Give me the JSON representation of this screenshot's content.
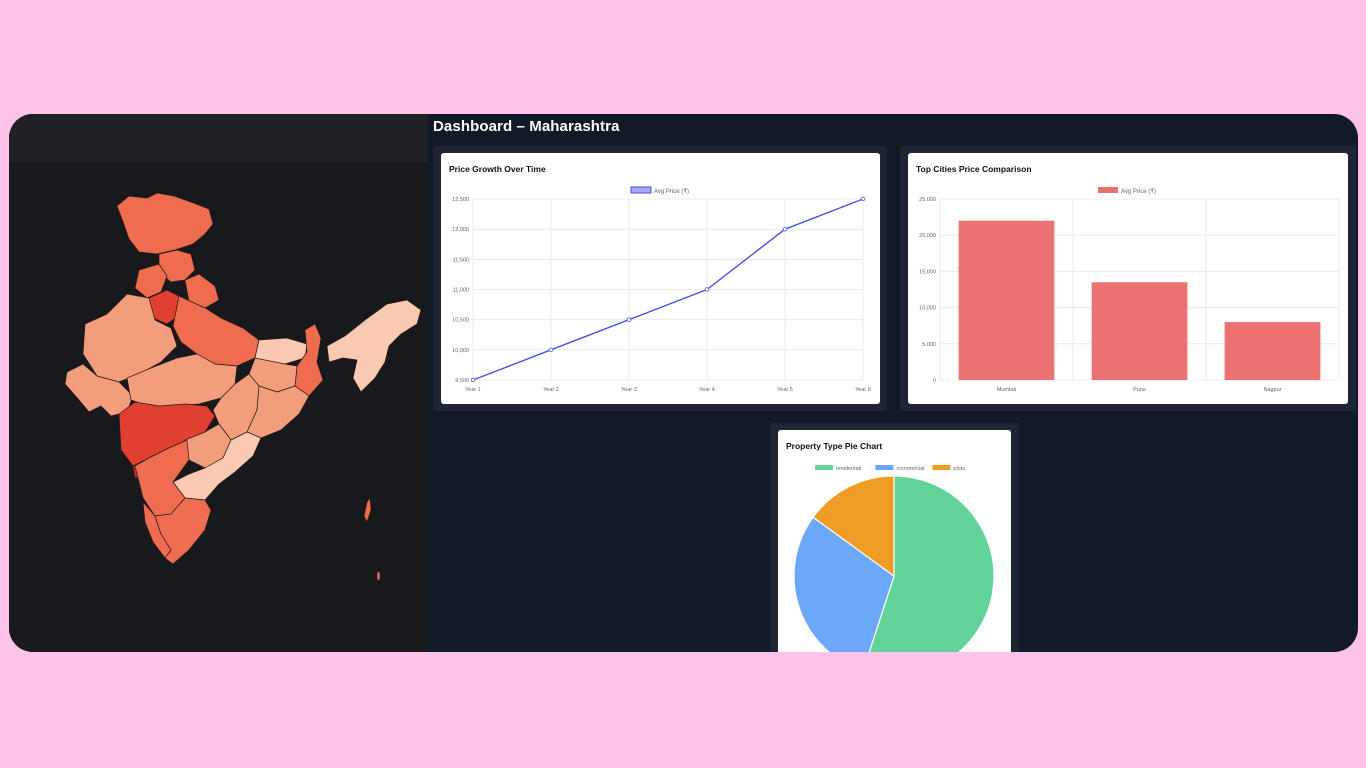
{
  "dashboard": {
    "title": "Dashboard – Maharashtra"
  },
  "map": {
    "selected_state": "Maharashtra",
    "fill_colors": [
      "#f9c9b2",
      "#f29e7c",
      "#ee6c4f",
      "#e23f33",
      "#d12e26"
    ]
  },
  "chart_data": [
    {
      "type": "line",
      "title": "Price Growth Over Time",
      "x": [
        "Year 1",
        "Year 2",
        "Year 3",
        "Year 4",
        "Year 5",
        "Year 6"
      ],
      "series": [
        {
          "name": "Avg Price (₹)",
          "values": [
            9500,
            10000,
            10500,
            11000,
            12000,
            12500
          ],
          "color": "#4b52e8"
        }
      ],
      "ylim": [
        9500,
        12500
      ],
      "yticks": [
        9500,
        10000,
        10500,
        11000,
        11500,
        12000,
        12500
      ],
      "ytick_labels": [
        "9,500",
        "10,000",
        "10,500",
        "11,000",
        "11,500",
        "12,000",
        "12,500"
      ],
      "grid": true,
      "legend": "top"
    },
    {
      "type": "bar",
      "title": "Top Cities Price Comparison",
      "categories": [
        "Mumbai",
        "Pune",
        "Nagpur"
      ],
      "series": [
        {
          "name": "Avg Price (₹)",
          "values": [
            22000,
            13500,
            8000
          ],
          "color": "#ec7171"
        }
      ],
      "ylim": [
        0,
        25000
      ],
      "yticks": [
        0,
        5000,
        10000,
        15000,
        20000,
        25000
      ],
      "ytick_labels": [
        "0",
        "5,000",
        "10,000",
        "15,000",
        "20,000",
        "25,000"
      ],
      "grid": true,
      "legend": "top"
    },
    {
      "type": "pie",
      "title": "Property Type Pie Chart",
      "labels": [
        "residential",
        "commercial",
        "plots"
      ],
      "values": [
        55,
        30,
        15
      ],
      "colors": [
        "#62d49a",
        "#6ca8f8",
        "#ee9e25"
      ],
      "legend": "top"
    }
  ]
}
